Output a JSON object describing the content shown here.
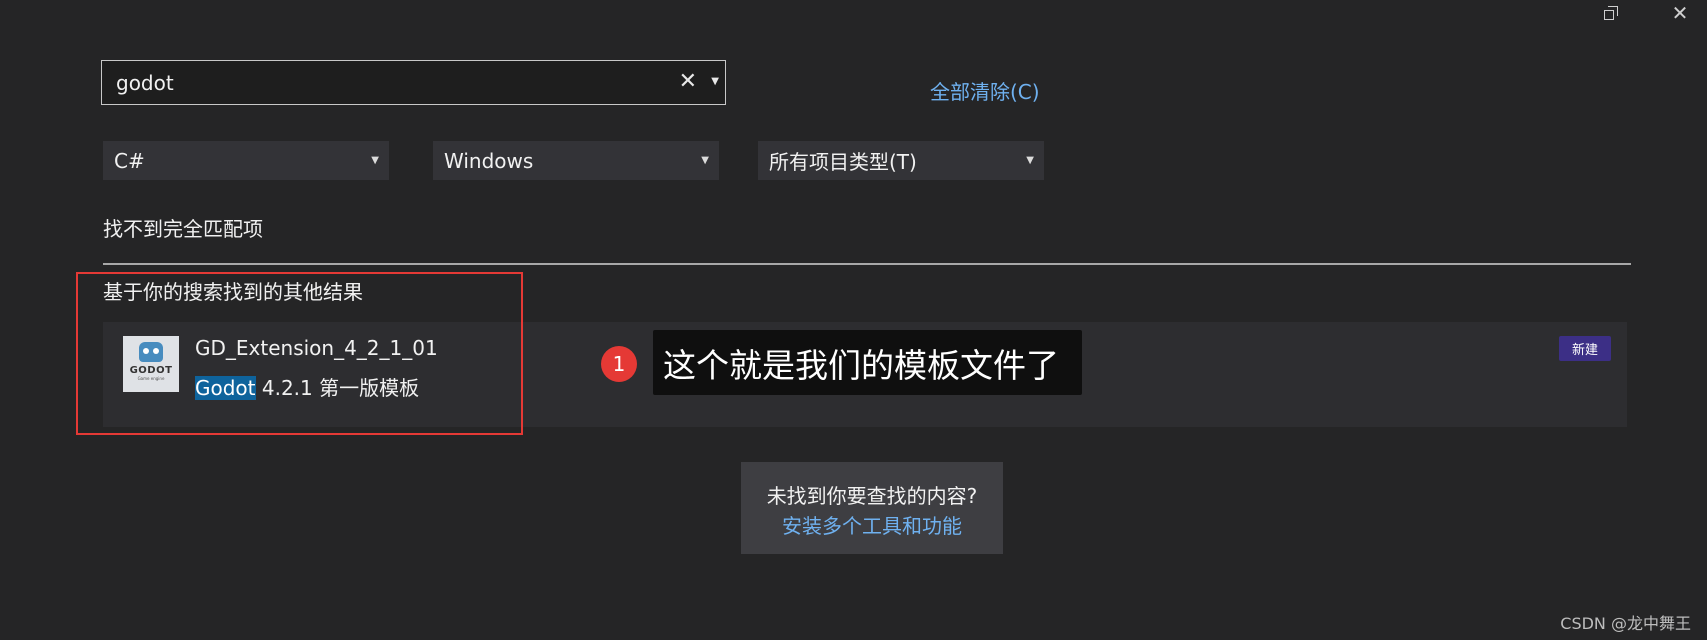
{
  "window": {
    "restore_icon": "restore-icon",
    "close_icon": "close-icon",
    "close_glyph": "✕"
  },
  "search": {
    "value": "godot",
    "clear_glyph": "✕",
    "caret_glyph": "▼",
    "clear_all_label": "全部清除(C)"
  },
  "filters": [
    {
      "value": "C#"
    },
    {
      "value": "Windows"
    },
    {
      "value": "所有项目类型(T)"
    }
  ],
  "no_exact_match": "找不到完全匹配项",
  "other_results_label": "基于你的搜索找到的其他结果",
  "result": {
    "icon_text": "GODOT",
    "icon_subtext": "Game engine",
    "title": "GD_Extension_4_2_1_01",
    "desc_highlight": "Godot",
    "desc_rest": " 4.2.1 第一版模板",
    "badge": "新建"
  },
  "callout": {
    "number": "1",
    "text": "这个就是我们的模板文件了"
  },
  "help": {
    "question": "未找到你要查找的内容?",
    "link": "安装多个工具和功能"
  },
  "watermark": "CSDN @龙中舞王",
  "colors": {
    "background": "#252526",
    "accent_link": "#6fb1f0",
    "highlight": "#0e639c",
    "badge": "#3c2f86",
    "annotation_red": "#e53935"
  }
}
